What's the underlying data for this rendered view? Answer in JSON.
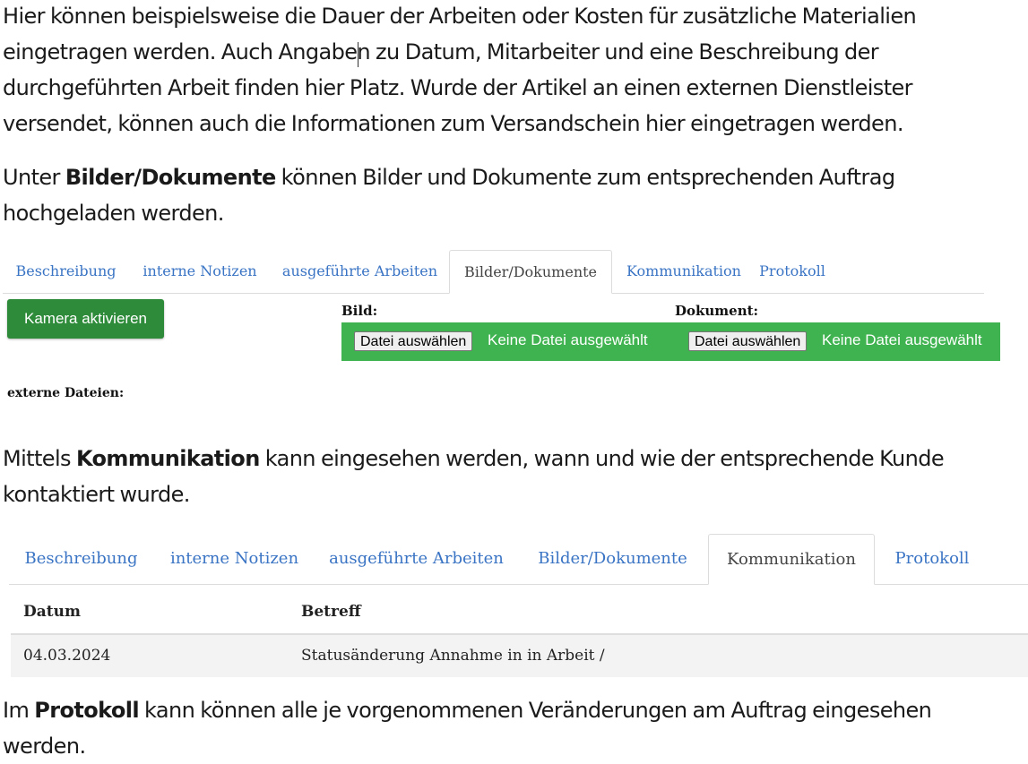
{
  "paragraphs": {
    "p1": {
      "lines": [
        "Hier können beispielsweise die Dauer der Arbeiten oder Kosten für zusätzliche Materialien",
        "eingetragen werden. Auch Angaben zu Datum, Mitarbeiter und eine Beschreibung der",
        "durchgeführten Arbeit finden hier Platz. Wurde der Artikel an einen externen Dienstleister",
        "versendet, können auch die Informationen zum Versandschein hier eingetragen werden."
      ]
    },
    "p2": {
      "pre": "Unter ",
      "bold": "Bilder/Dokumente",
      "post": " können Bilder und Dokumente zum entsprechenden Auftrag",
      "line2": "hochgeladen werden."
    },
    "p3": {
      "pre": "Mittels ",
      "bold": "Kommunikation",
      "post": " kann eingesehen werden, wann und wie der entsprechende Kunde",
      "line2": "kontaktiert wurde."
    },
    "p4": {
      "pre": "Im ",
      "bold": "Protokoll",
      "post": " kann können alle je vorgenommenen Veränderungen am Auftrag eingesehen",
      "line2": "werden."
    }
  },
  "tabs1": {
    "items": [
      "Beschreibung",
      "interne Notizen",
      "ausgeführte Arbeiten",
      "Bilder/Dokumente",
      "Kommunikation",
      "Protokoll"
    ],
    "active": "Bilder/Dokumente"
  },
  "upload": {
    "camera_button": "Kamera aktivieren",
    "image_label": "Bild:",
    "document_label": "Dokument:",
    "choose_file": "Datei auswählen",
    "no_file": "Keine Datei ausgewählt",
    "external_label": "externe Dateien:",
    "accent_color": "#3fb34f",
    "button_color": "#2e8b3a"
  },
  "tabs2": {
    "items": [
      "Beschreibung",
      "interne Notizen",
      "ausgeführte Arbeiten",
      "Bilder/Dokumente",
      "Kommunikation",
      "Protokoll"
    ],
    "active": "Kommunikation"
  },
  "comm_table": {
    "columns": [
      "Datum",
      "Betreff"
    ],
    "rows": [
      [
        "04.03.2024",
        "Statusänderung Annahme in in Arbeit /"
      ]
    ]
  },
  "link_color": "#3a74c4"
}
